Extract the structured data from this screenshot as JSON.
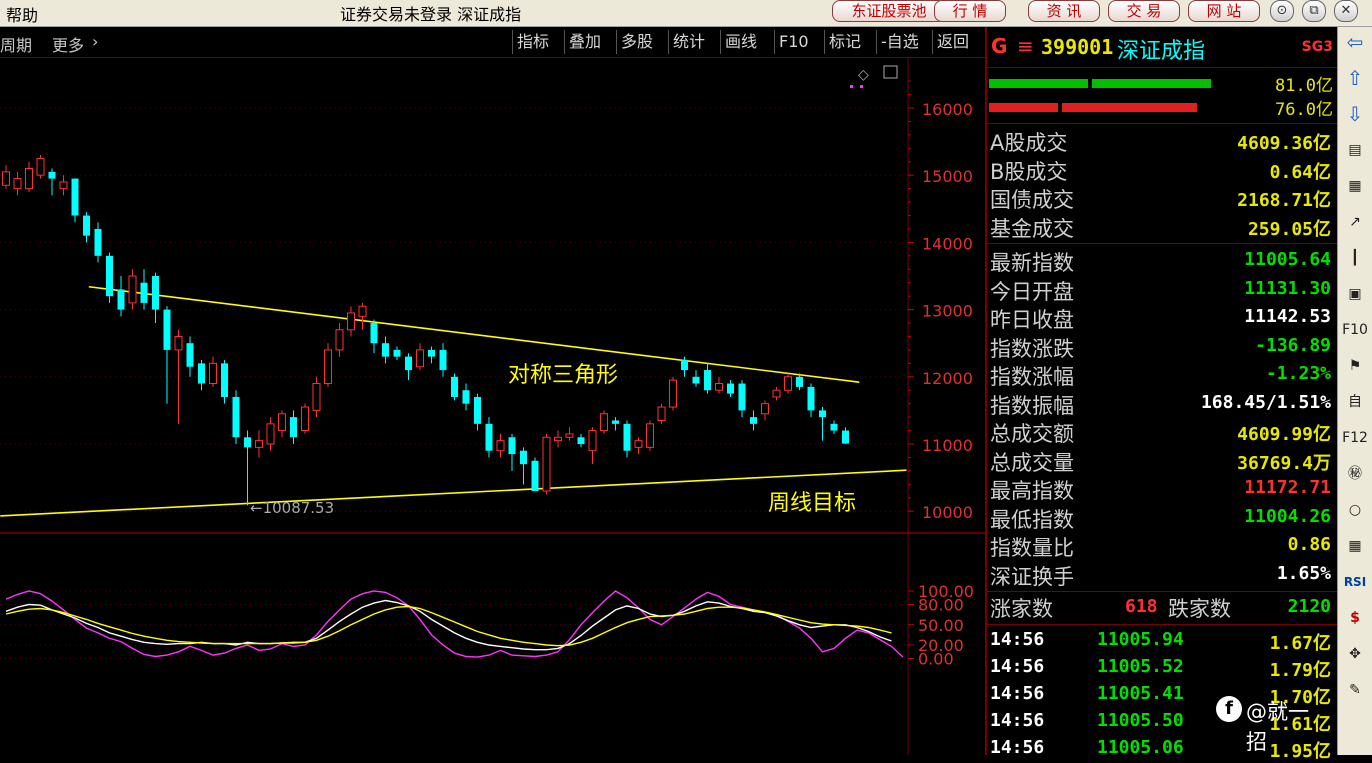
{
  "titlebar": {
    "help": "帮助",
    "title": "证券交易未登录  深证成指",
    "buttons": [
      "东证股票池",
      "行 情",
      "资 讯",
      "交 易",
      "网 站"
    ],
    "win_controls": [
      "⊙",
      "⧉",
      "✕"
    ]
  },
  "toolbar": {
    "period": "周期",
    "more": "更多",
    "buttons": [
      "指标",
      "叠加",
      "多股",
      "统计",
      "画线",
      "F10",
      "标记",
      "-自选",
      "返回"
    ]
  },
  "chart_data": [
    {
      "type": "candlestick",
      "annotations": [
        "对称三角形",
        "周线目标",
        "←10087.53"
      ],
      "y_ticks": [
        "16000",
        "15000",
        "14000",
        "13000",
        "12000",
        "11000",
        "10000"
      ],
      "ylim": [
        9950,
        16400
      ],
      "low_marker": 10087.53,
      "candles": [
        {
          "o": 14850,
          "c": 15050,
          "h": 15150,
          "l": 14800
        },
        {
          "o": 14800,
          "c": 14950,
          "h": 15050,
          "l": 14700
        },
        {
          "o": 14800,
          "c": 15100,
          "h": 15200,
          "l": 14750
        },
        {
          "o": 15000,
          "c": 15250,
          "h": 15300,
          "l": 14950
        },
        {
          "o": 15050,
          "c": 14950,
          "h": 15100,
          "l": 14700
        },
        {
          "o": 14800,
          "c": 14900,
          "h": 15000,
          "l": 14700
        },
        {
          "o": 14950,
          "c": 14400,
          "h": 14950,
          "l": 14300
        },
        {
          "o": 14400,
          "c": 14100,
          "h": 14450,
          "l": 14000
        },
        {
          "o": 14200,
          "c": 13800,
          "h": 14300,
          "l": 13700
        },
        {
          "o": 13800,
          "c": 13200,
          "h": 13850,
          "l": 13100
        },
        {
          "o": 13300,
          "c": 13000,
          "h": 13500,
          "l": 12900
        },
        {
          "o": 13100,
          "c": 13500,
          "h": 13600,
          "l": 13000
        },
        {
          "o": 13400,
          "c": 13100,
          "h": 13600,
          "l": 13000
        },
        {
          "o": 13500,
          "c": 13000,
          "h": 13550,
          "l": 12800
        },
        {
          "o": 13000,
          "c": 12400,
          "h": 13050,
          "l": 11600
        },
        {
          "o": 12400,
          "c": 12600,
          "h": 12700,
          "l": 11300
        },
        {
          "o": 12500,
          "c": 12150,
          "h": 12600,
          "l": 12000
        },
        {
          "o": 12200,
          "c": 11900,
          "h": 12250,
          "l": 11800
        },
        {
          "o": 11900,
          "c": 12200,
          "h": 12300,
          "l": 11850
        },
        {
          "o": 12200,
          "c": 11700,
          "h": 12250,
          "l": 11600
        },
        {
          "o": 11700,
          "c": 11100,
          "h": 11800,
          "l": 11000
        },
        {
          "o": 11100,
          "c": 10950,
          "h": 11200,
          "l": 10087.53
        },
        {
          "o": 10950,
          "c": 11050,
          "h": 11200,
          "l": 10800
        },
        {
          "o": 11000,
          "c": 11300,
          "h": 11400,
          "l": 10900
        },
        {
          "o": 11200,
          "c": 11450,
          "h": 11500,
          "l": 11100
        },
        {
          "o": 11400,
          "c": 11100,
          "h": 11500,
          "l": 11000
        },
        {
          "o": 11200,
          "c": 11550,
          "h": 11600,
          "l": 11150
        },
        {
          "o": 11500,
          "c": 11900,
          "h": 12000,
          "l": 11400
        },
        {
          "o": 11900,
          "c": 12400,
          "h": 12500,
          "l": 11850
        },
        {
          "o": 12400,
          "c": 12700,
          "h": 12800,
          "l": 12300
        },
        {
          "o": 12700,
          "c": 12950,
          "h": 13050,
          "l": 12600
        },
        {
          "o": 12900,
          "c": 13050,
          "h": 13100,
          "l": 12700
        },
        {
          "o": 12800,
          "c": 12500,
          "h": 12850,
          "l": 12350
        },
        {
          "o": 12500,
          "c": 12300,
          "h": 12600,
          "l": 12200
        },
        {
          "o": 12400,
          "c": 12300,
          "h": 12450,
          "l": 12250
        },
        {
          "o": 12300,
          "c": 12100,
          "h": 12350,
          "l": 11950
        },
        {
          "o": 12150,
          "c": 12400,
          "h": 12500,
          "l": 12100
        },
        {
          "o": 12400,
          "c": 12300,
          "h": 12450,
          "l": 12200
        },
        {
          "o": 12400,
          "c": 12100,
          "h": 12500,
          "l": 12000
        },
        {
          "o": 12000,
          "c": 11700,
          "h": 12050,
          "l": 11650
        },
        {
          "o": 11800,
          "c": 11600,
          "h": 11900,
          "l": 11500
        },
        {
          "o": 11700,
          "c": 11300,
          "h": 11750,
          "l": 11200
        },
        {
          "o": 11300,
          "c": 10900,
          "h": 11400,
          "l": 10800
        },
        {
          "o": 10900,
          "c": 11050,
          "h": 11150,
          "l": 10800
        },
        {
          "o": 11100,
          "c": 10850,
          "h": 11150,
          "l": 10600
        },
        {
          "o": 10900,
          "c": 10700,
          "h": 10950,
          "l": 10400
        },
        {
          "o": 10750,
          "c": 10300,
          "h": 10800,
          "l": 10300
        },
        {
          "o": 10300,
          "c": 11100,
          "h": 11150,
          "l": 10250
        },
        {
          "o": 11050,
          "c": 11100,
          "h": 11200,
          "l": 10950
        },
        {
          "o": 11100,
          "c": 11150,
          "h": 11250,
          "l": 11050
        },
        {
          "o": 11100,
          "c": 11000,
          "h": 11150,
          "l": 10950
        },
        {
          "o": 10900,
          "c": 11200,
          "h": 11250,
          "l": 10700
        },
        {
          "o": 11200,
          "c": 11450,
          "h": 11500,
          "l": 11150
        },
        {
          "o": 11350,
          "c": 11300,
          "h": 11400,
          "l": 11200
        },
        {
          "o": 11300,
          "c": 10900,
          "h": 11350,
          "l": 10800
        },
        {
          "o": 10950,
          "c": 11050,
          "h": 11100,
          "l": 10850
        },
        {
          "o": 10950,
          "c": 11300,
          "h": 11350,
          "l": 10900
        },
        {
          "o": 11350,
          "c": 11550,
          "h": 11600,
          "l": 11300
        },
        {
          "o": 11550,
          "c": 11950,
          "h": 12000,
          "l": 11500
        },
        {
          "o": 12250,
          "c": 12100,
          "h": 12300,
          "l": 12000
        },
        {
          "o": 12000,
          "c": 11900,
          "h": 12100,
          "l": 11850
        },
        {
          "o": 12100,
          "c": 11800,
          "h": 12200,
          "l": 11750
        },
        {
          "o": 11800,
          "c": 11900,
          "h": 12000,
          "l": 11750
        },
        {
          "o": 11900,
          "c": 11750,
          "h": 11950,
          "l": 11700
        },
        {
          "o": 11900,
          "c": 11500,
          "h": 11950,
          "l": 11400
        },
        {
          "o": 11400,
          "c": 11300,
          "h": 11500,
          "l": 11200
        },
        {
          "o": 11450,
          "c": 11600,
          "h": 11650,
          "l": 11350
        },
        {
          "o": 11700,
          "c": 11800,
          "h": 11850,
          "l": 11650
        },
        {
          "o": 11800,
          "c": 12000,
          "h": 12050,
          "l": 11750
        },
        {
          "o": 12000,
          "c": 11850,
          "h": 12050,
          "l": 11800
        },
        {
          "o": 11850,
          "c": 11500,
          "h": 11900,
          "l": 11400
        },
        {
          "o": 11500,
          "c": 11400,
          "h": 11550,
          "l": 11050
        },
        {
          "o": 11300,
          "c": 11200,
          "h": 11350,
          "l": 11150
        },
        {
          "o": 11200,
          "c": 11005.64,
          "h": 11250,
          "l": 11000
        }
      ],
      "trendlines": [
        {
          "x1": -0.8,
          "y1": 13340,
          "x2": 36.2,
          "y2": 11920
        },
        {
          "x1": -8.5,
          "y1": 9930,
          "x2": 40.3,
          "y2": 10610
        }
      ]
    },
    {
      "type": "line",
      "y_ticks": [
        "100.00",
        "80.00",
        "50.00",
        "20.00",
        "0.00"
      ],
      "ylim": [
        -10,
        115
      ],
      "series": [
        {
          "color": "#ff33ff",
          "values": [
            88,
            95,
            100,
            96,
            85,
            72,
            58,
            45,
            38,
            30,
            25,
            15,
            6,
            3,
            5,
            10,
            18,
            12,
            5,
            8,
            15,
            20,
            12,
            14,
            22,
            18,
            20,
            35,
            55,
            72,
            88,
            96,
            100,
            98,
            90,
            78,
            58,
            35,
            20,
            8,
            3,
            2,
            5,
            12,
            5,
            4,
            3,
            5,
            10,
            28,
            50,
            68,
            85,
            100,
            90,
            75,
            58,
            50,
            62,
            75,
            88,
            98,
            92,
            80,
            76,
            72,
            68,
            65,
            55,
            45,
            30,
            10,
            15,
            30,
            42,
            38,
            28,
            18,
            2
          ]
        },
        {
          "color": "#ffffff",
          "values": [
            70,
            76,
            80,
            79,
            72,
            66,
            60,
            52,
            46,
            38,
            33,
            28,
            24,
            22,
            21,
            22,
            22,
            24,
            22,
            22,
            20,
            24,
            22,
            22,
            23,
            24,
            24,
            30,
            42,
            55,
            66,
            76,
            82,
            86,
            83,
            78,
            70,
            58,
            48,
            38,
            30,
            24,
            20,
            18,
            16,
            14,
            13,
            13,
            15,
            22,
            34,
            48,
            60,
            72,
            78,
            74,
            66,
            62,
            64,
            70,
            78,
            84,
            82,
            77,
            74,
            70,
            68,
            63,
            56,
            50,
            46,
            48,
            50,
            50,
            46,
            40,
            32,
            26
          ]
        },
        {
          "color": "#ffff00",
          "values": [
            66,
            70,
            73,
            74,
            72,
            68,
            63,
            58,
            52,
            47,
            42,
            37,
            33,
            30,
            27,
            25,
            24,
            23,
            22,
            22,
            22,
            22,
            22,
            22,
            23,
            23,
            24,
            27,
            33,
            41,
            50,
            58,
            66,
            72,
            76,
            77,
            74,
            68,
            61,
            54,
            47,
            40,
            35,
            30,
            27,
            24,
            22,
            20,
            19,
            20,
            24,
            30,
            38,
            46,
            53,
            58,
            62,
            63,
            64,
            66,
            70,
            74,
            76,
            76,
            75,
            72,
            69,
            65,
            61,
            57,
            53,
            51,
            50,
            49,
            48,
            46,
            42,
            38
          ]
        }
      ]
    }
  ],
  "right_panel": {
    "header": {
      "g": "G",
      "menu": "≡",
      "code": "399001",
      "name": "深证成指",
      "tag": "SG3"
    },
    "bars": [
      {
        "value": 81.0,
        "value_text": "81.0亿",
        "color": "#00c000"
      },
      {
        "value": 76.0,
        "value_text": "76.0亿",
        "color": "#e02020"
      }
    ],
    "volumes": [
      {
        "label": "A股成交",
        "value": "4609.36亿",
        "color": "#e8e800"
      },
      {
        "label": "B股成交",
        "value": "0.64亿",
        "color": "#e8e800"
      },
      {
        "label": "国债成交",
        "value": "2168.71亿",
        "color": "#e8e800"
      },
      {
        "label": "基金成交",
        "value": "259.05亿",
        "color": "#e8e800"
      }
    ],
    "stats": [
      {
        "label": "最新指数",
        "value": "11005.64",
        "color": "#00e000"
      },
      {
        "label": "今日开盘",
        "value": "11131.30",
        "color": "#00e000"
      },
      {
        "label": "昨日收盘",
        "value": "11142.53",
        "color": "#ffffff"
      },
      {
        "label": "指数涨跌",
        "value": "-136.89",
        "color": "#00e000"
      },
      {
        "label": "指数涨幅",
        "value": "-1.23%",
        "color": "#00e000"
      },
      {
        "label": "指数振幅",
        "value": "168.45/1.51%",
        "color": "#ffffff"
      },
      {
        "label": "总成交额",
        "value": "4609.99亿",
        "color": "#e8e800"
      },
      {
        "label": "总成交量",
        "value": "36769.4万",
        "color": "#e8e800"
      },
      {
        "label": "最高指数",
        "value": "11172.71",
        "color": "#ff3030"
      },
      {
        "label": "最低指数",
        "value": "11004.26",
        "color": "#00e000"
      },
      {
        "label": "指数量比",
        "value": "0.86",
        "color": "#e8e800"
      },
      {
        "label": "深证换手",
        "value": "1.65%",
        "color": "#ffffff"
      }
    ],
    "updown": {
      "up_label": "涨家数",
      "up_value": "618",
      "down_label": "跌家数",
      "down_value": "2120"
    },
    "ticks": [
      {
        "time": "14:56",
        "price": "11005.94",
        "amount": "1.67亿"
      },
      {
        "time": "14:56",
        "price": "11005.52",
        "amount": "1.79亿"
      },
      {
        "time": "14:56",
        "price": "11005.41",
        "amount": "1.70亿"
      },
      {
        "time": "14:56",
        "price": "11005.50",
        "amount": "1.61亿"
      },
      {
        "time": "14:56",
        "price": "11005.06",
        "amount": "1.95亿"
      }
    ]
  },
  "sidebar_icons": [
    "back-arrow-icon",
    "up-arrow-icon",
    "down-arrow-icon",
    "quote-list-icon",
    "grid-icon",
    "trend-icon",
    "kline-icon",
    "window-icon",
    "f10-icon",
    "flag-icon",
    "zi-icon",
    "f12-icon",
    "tag-icon",
    "circle-icon",
    "grid2-icon",
    "rsi-icon",
    "dollar-icon",
    "move-icon",
    "pen-icon"
  ],
  "sidebar_labels": [
    "⇦",
    "⇧",
    "⇩",
    "▤",
    "▦",
    "↗",
    "┃",
    "▣",
    "F10",
    "⚑",
    "自",
    "F12",
    "㊙",
    "○",
    "▦",
    "RSI",
    "$",
    "✥",
    "✎"
  ],
  "watermark": "@就一招"
}
